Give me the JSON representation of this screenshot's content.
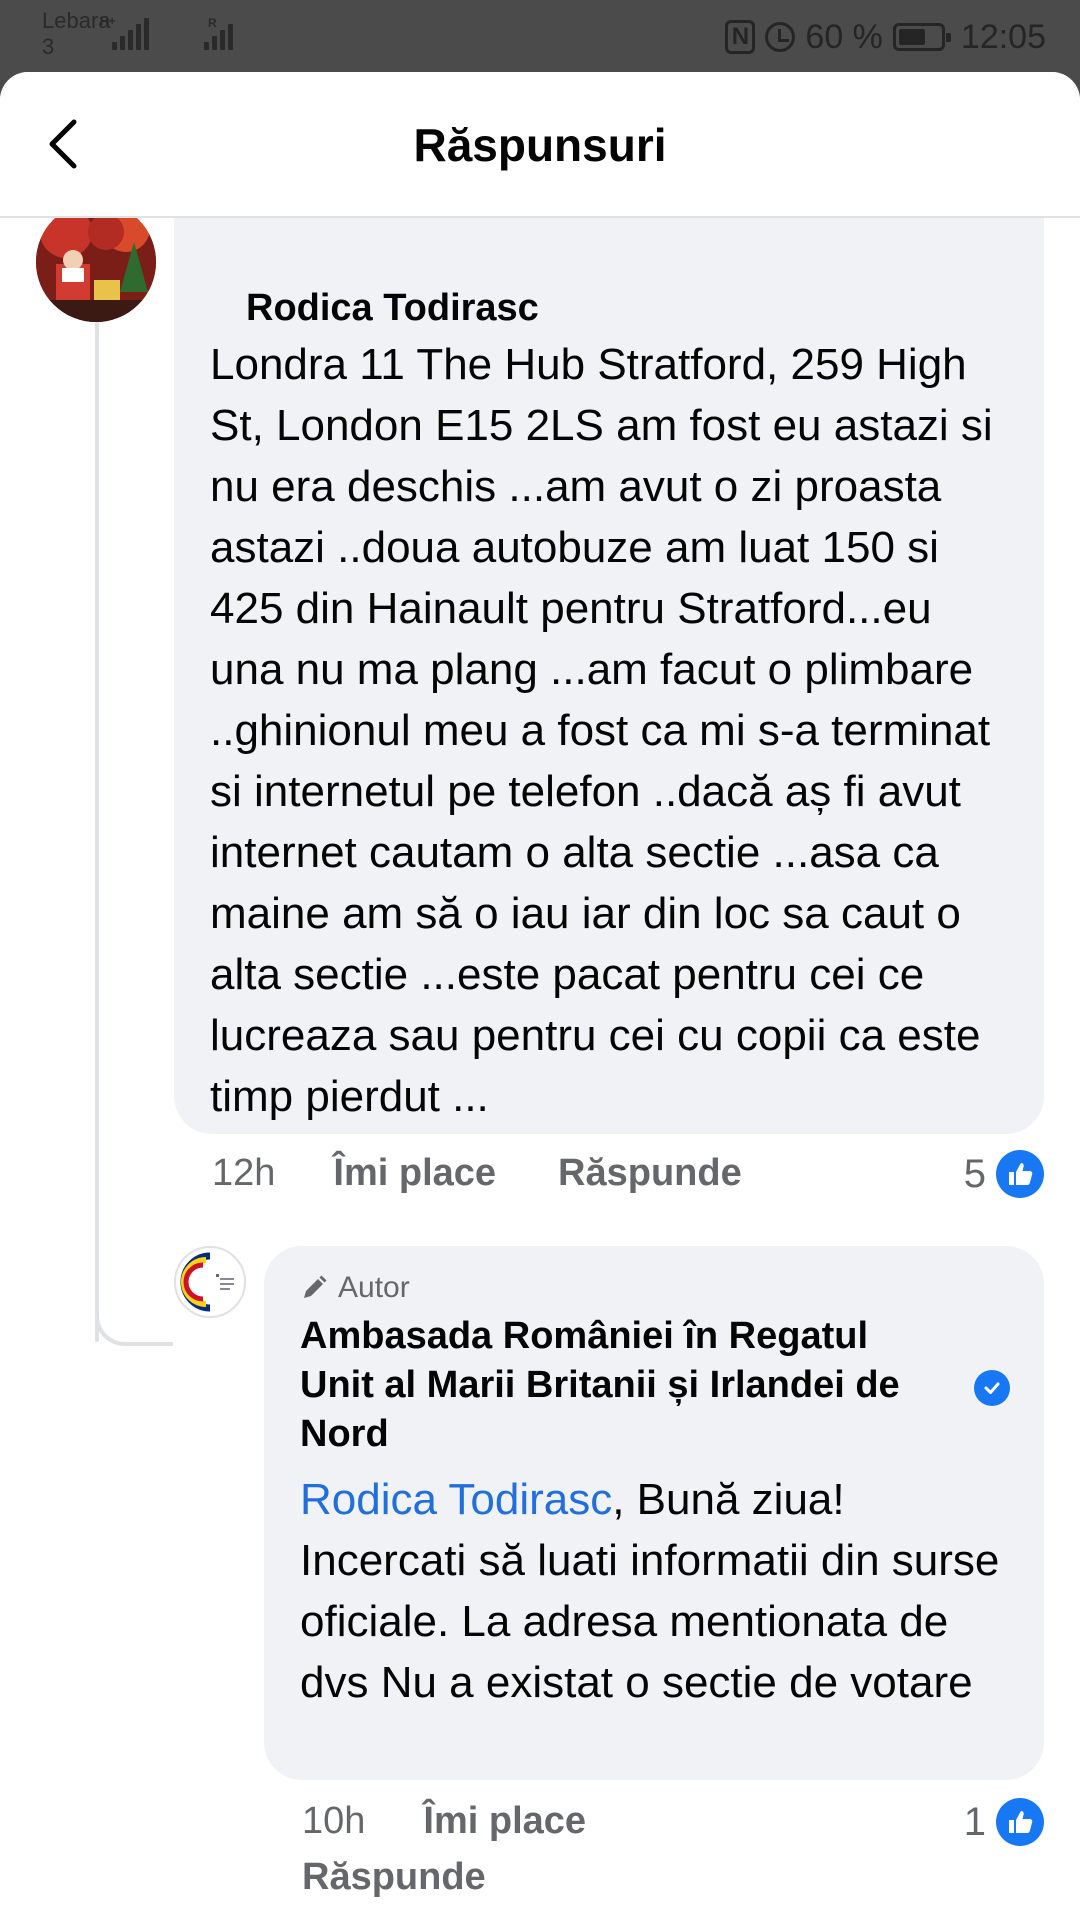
{
  "status_bar": {
    "carrier": "Lebara",
    "carrier_sub": "3",
    "network_type": "H+",
    "roaming": "R",
    "nfc": "N",
    "battery": "60 %",
    "time": "12:05"
  },
  "header": {
    "title": "Răspunsuri",
    "back_icon": "chevron-left-icon"
  },
  "comments": [
    {
      "author": "Rodica Todirasc",
      "text": "Londra 11 The Hub Stratford, 259 High St, London E15 2LS am fost eu astazi si nu era deschis ...am avut o zi proasta astazi ..doua autobuze am luat 150 si 425 din Hainault pentru Stratford...eu una nu ma plang ...am facut o plimbare ..ghinionul meu a fost ca mi s-a terminat si internetul pe telefon ..dacă aș fi avut internet cautam o alta sectie ...asa ca maine am să o iau iar din loc sa caut o alta sectie ...este pacat pentru cei ce lucreaza sau pentru cei cu copii ca este timp pierdut ...",
      "time": "12h",
      "like_label": "Îmi place",
      "reply_label": "Răspunde",
      "likes": "5"
    },
    {
      "badge": "Autor",
      "author": "Ambasada României în Regatul Unit al Marii Britanii și Irlandei de Nord",
      "mention": "Rodica Todirasc",
      "text": ", Bună ziua! Incercati să luati informatii din surse oficiale. La adresa mentionata de dvs Nu a existat o sectie de votare",
      "time": "10h",
      "like_label": "Îmi place",
      "reply_label": "Răspunde",
      "likes": "1"
    }
  ],
  "colors": {
    "accent": "#1877f2",
    "mention": "#216fdb",
    "bubble": "#f0f2f5",
    "meta_text": "#65676b"
  }
}
